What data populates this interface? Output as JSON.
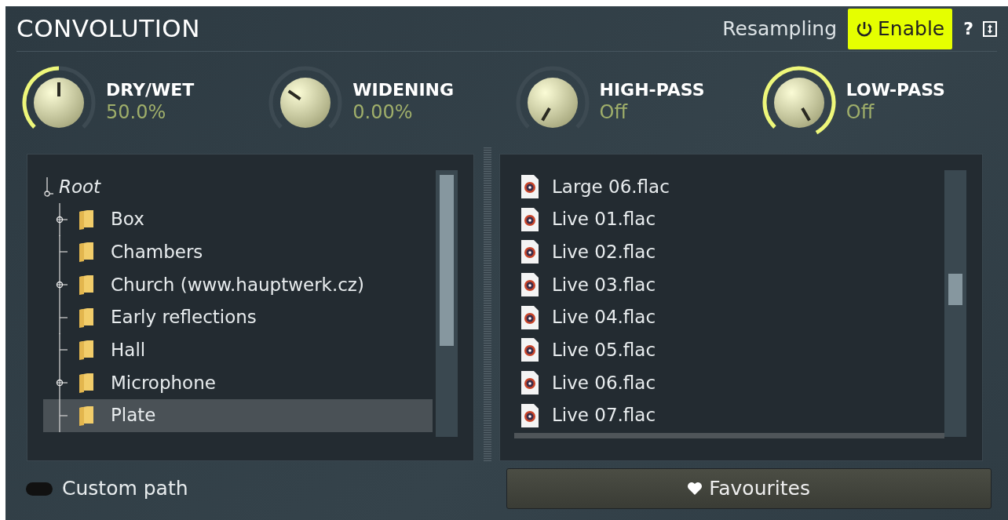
{
  "title": "CONVOLUTION",
  "header": {
    "resampling_label": "Resampling",
    "enable": {
      "label": "Enable",
      "on": true
    },
    "help": "?"
  },
  "knobs": [
    {
      "name": "DRY/WET",
      "value": "50.0%",
      "kind": "arc"
    },
    {
      "name": "WIDENING",
      "value": "0.00%",
      "kind": "no-arc"
    },
    {
      "name": "HIGH-PASS",
      "value": "Off",
      "kind": "arc"
    },
    {
      "name": "LOW-PASS",
      "value": "Off",
      "kind": "arc"
    }
  ],
  "tree": {
    "label": "Root",
    "expanded": true,
    "children": [
      {
        "label": "Box",
        "expandable": true,
        "selected": false
      },
      {
        "label": "Chambers",
        "expandable": false,
        "selected": false
      },
      {
        "label": "Church (www.hauptwerk.cz)",
        "expandable": true,
        "selected": false
      },
      {
        "label": "Early reflections",
        "expandable": false,
        "selected": false
      },
      {
        "label": "Hall",
        "expandable": false,
        "selected": false
      },
      {
        "label": "Microphone",
        "expandable": true,
        "selected": false
      },
      {
        "label": "Plate",
        "expandable": false,
        "selected": true
      }
    ]
  },
  "files": [
    "Large 06.flac",
    "Live 01.flac",
    "Live 02.flac",
    "Live 03.flac",
    "Live 04.flac",
    "Live 05.flac",
    "Live 06.flac",
    "Live 07.flac"
  ],
  "custom_path": {
    "label": "Custom path",
    "on": false
  },
  "favourites": {
    "label": "Favourites"
  }
}
